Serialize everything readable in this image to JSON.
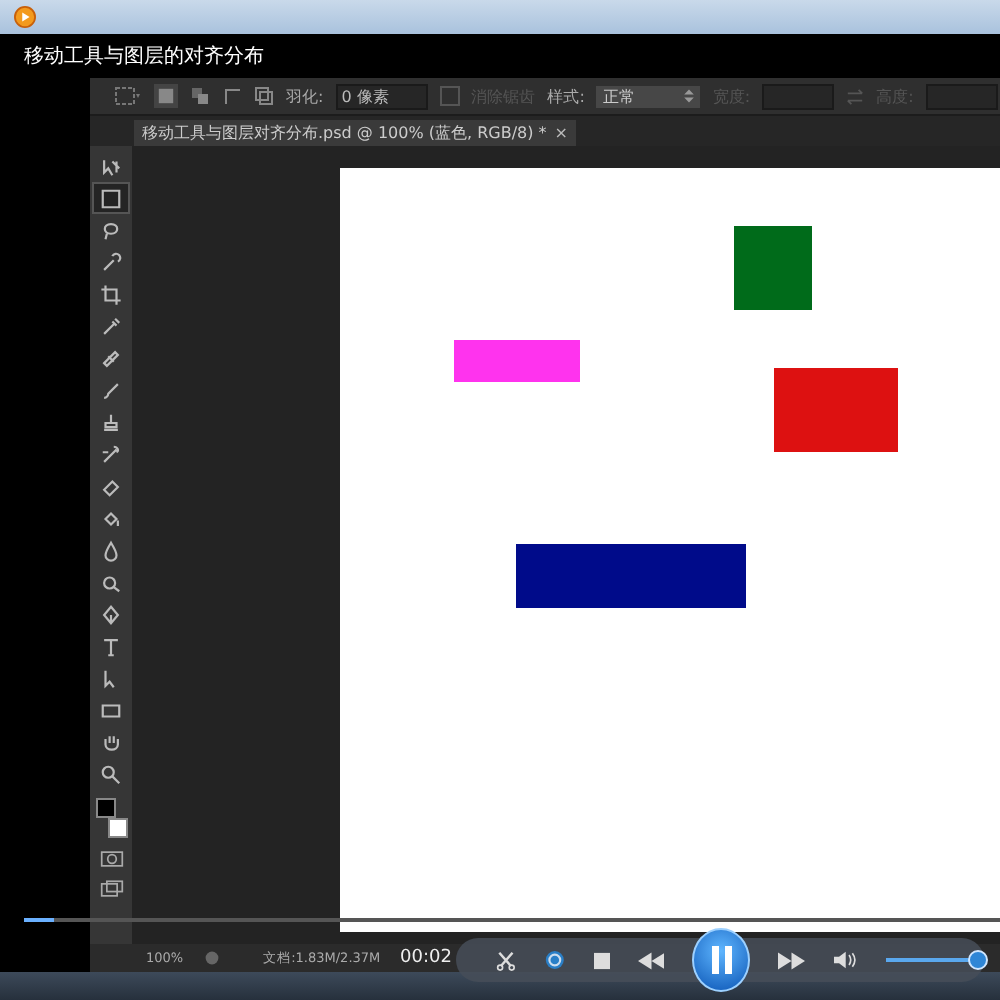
{
  "player": {
    "title": "移动工具与图层的对齐分布",
    "time": "00:02",
    "playing": true,
    "progress": {
      "level": 0.03
    },
    "volume": {
      "level": 0.93
    }
  },
  "options_bar": {
    "feather_label": "羽化:",
    "feather_value": "0 像素",
    "anti_alias": {
      "label": "消除锯齿",
      "checked": false,
      "disabled": true
    },
    "style_label": "样式:",
    "style_value": "正常",
    "width_label": "宽度:",
    "height_label": "高度:"
  },
  "document_tab": {
    "title": "移动工具与图层对齐分布.psd @ 100% (蓝色, RGB/8) *",
    "close": "×"
  },
  "tools": [
    {
      "kind": "move",
      "selected": false
    },
    {
      "kind": "marquee",
      "selected": true
    },
    {
      "kind": "lasso",
      "selected": false
    },
    {
      "kind": "quick-select",
      "selected": false
    },
    {
      "kind": "crop",
      "selected": false
    },
    {
      "kind": "eyedropper",
      "selected": false
    },
    {
      "kind": "healing",
      "selected": false
    },
    {
      "kind": "brush",
      "selected": false
    },
    {
      "kind": "stamp",
      "selected": false
    },
    {
      "kind": "history-brush",
      "selected": false
    },
    {
      "kind": "eraser",
      "selected": false
    },
    {
      "kind": "bucket",
      "selected": false
    },
    {
      "kind": "blur",
      "selected": false
    },
    {
      "kind": "dodge",
      "selected": false
    },
    {
      "kind": "pen",
      "selected": false
    },
    {
      "kind": "type",
      "selected": false
    },
    {
      "kind": "path-select",
      "selected": false
    },
    {
      "kind": "rectangle",
      "selected": false
    },
    {
      "kind": "hand",
      "selected": false
    },
    {
      "kind": "zoom",
      "selected": false
    }
  ],
  "canvas": {
    "layers": [
      {
        "color": "#006b1a"
      },
      {
        "color": "#ff33ee"
      },
      {
        "color": "#dd1111"
      },
      {
        "color": "#000b8a"
      }
    ]
  },
  "status_bar": {
    "zoom": "100%",
    "doc_size": "文档:1.83M/2.37M"
  }
}
